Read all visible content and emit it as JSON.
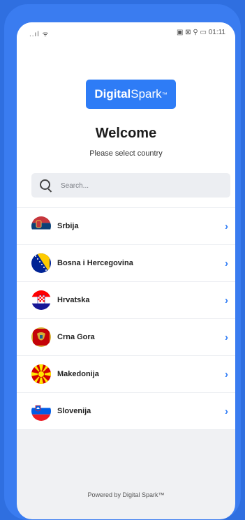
{
  "status_bar": {
    "left": "..ıl ᯤ",
    "right": "▣ ⊠ ⚲ ▭ 01:11"
  },
  "logo": {
    "bold": "Digital",
    "light": "Spark",
    "tm": "™"
  },
  "header": {
    "title": "Welcome",
    "subtitle": "Please select country"
  },
  "search": {
    "placeholder": "Search..."
  },
  "countries": [
    {
      "label": "Srbija",
      "icon": "serbia-flag"
    },
    {
      "label": "Bosna i Hercegovina",
      "icon": "bosnia-flag"
    },
    {
      "label": "Hrvatska",
      "icon": "croatia-flag"
    },
    {
      "label": "Crna Gora",
      "icon": "montenegro-flag"
    },
    {
      "label": "Makedonija",
      "icon": "macedonia-flag"
    },
    {
      "label": "Slovenija",
      "icon": "slovenia-flag"
    }
  ],
  "chevron": "›",
  "footer": {
    "powered": "Powered by Digital Spark™"
  },
  "colors": {
    "accent": "#2e7cf6",
    "frame": "#3a7cf0"
  }
}
